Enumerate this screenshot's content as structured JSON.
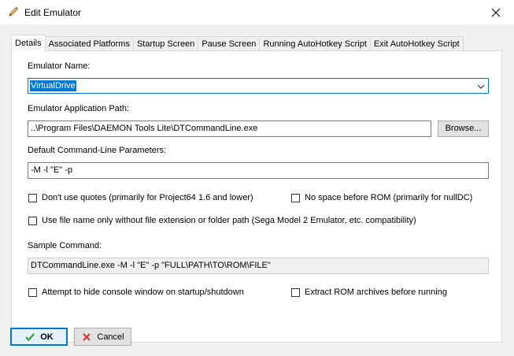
{
  "window": {
    "title": "Edit Emulator",
    "close_icon": "close-icon",
    "title_icon": "pencil-icon"
  },
  "tabs": [
    {
      "label": "Details"
    },
    {
      "label": "Associated Platforms"
    },
    {
      "label": "Startup Screen"
    },
    {
      "label": "Pause Screen"
    },
    {
      "label": "Running AutoHotkey Script"
    },
    {
      "label": "Exit AutoHotkey Script"
    }
  ],
  "details": {
    "name_label": "Emulator Name:",
    "name_value": "VirtualDrive",
    "path_label": "Emulator Application Path:",
    "path_value": "..\\Program Files\\DAEMON Tools Lite\\DTCommandLine.exe",
    "browse_label": "Browse...",
    "params_label": "Default Command-Line Parameters:",
    "params_value": "-M -l \"E\"  -p",
    "no_quotes_label": "Don't use quotes (primarily for Project64 1.6 and lower)",
    "no_space_label": "No space before ROM (primarily for nullDC)",
    "filename_only_label": "Use file name only without file extension or folder path (Sega Model 2 Emulator, etc. compatibility)",
    "sample_label": "Sample Command:",
    "sample_value": "DTCommandLine.exe -M -l \"E\"  -p \"FULL\\PATH\\TO\\ROM\\FILE\"",
    "hide_console_label": "Attempt to hide console window on startup/shutdown",
    "extract_label": "Extract ROM archives before running"
  },
  "footer": {
    "ok_label": "OK",
    "cancel_label": "Cancel"
  },
  "colors": {
    "accent": "#0078d7",
    "ok_check": "#2e9e2e",
    "cancel_x": "#d13438"
  }
}
